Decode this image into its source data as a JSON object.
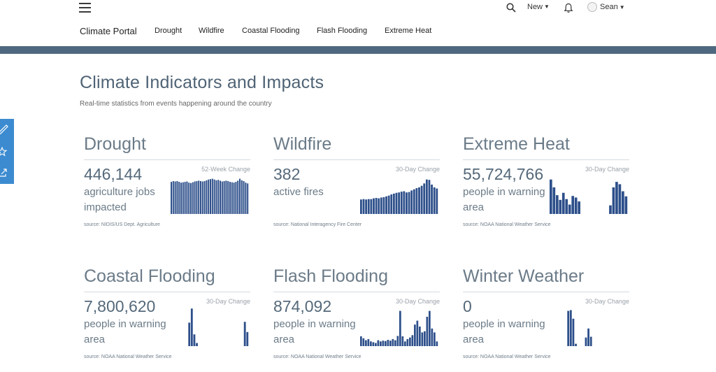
{
  "header": {
    "new_label": "New",
    "user_name": "Sean",
    "brand": "Climate Portal",
    "nav": [
      "Drought",
      "Wildfire",
      "Coastal Flooding",
      "Flash Flooding",
      "Extreme Heat"
    ]
  },
  "main": {
    "title": "Climate Indicators and Impacts",
    "subtitle": "Real-time statistics from events happening around the country"
  },
  "colors": {
    "accent_bar": "#4e687f",
    "side_tab": "#3c8bd0",
    "chart_bars": "#2d4f8a"
  },
  "icons": [
    "menu-icon",
    "search-icon",
    "bell-icon",
    "pencil-icon",
    "star-icon",
    "share-icon"
  ],
  "cards": [
    {
      "title": "Drought",
      "value": "446,144",
      "description": "agriculture jobs impacted",
      "change_label": "52-Week Change",
      "source": "source: NIDIS/US Dept. Agriculture",
      "series": [
        0.82,
        0.84,
        0.83,
        0.84,
        0.82,
        0.8,
        0.81,
        0.82,
        0.83,
        0.8,
        0.79,
        0.81,
        0.83,
        0.84,
        0.85,
        0.84,
        0.83,
        0.84,
        0.86,
        0.88,
        0.89,
        0.9,
        0.88,
        0.86,
        0.87,
        0.85,
        0.83,
        0.84,
        0.85,
        0.84,
        0.82,
        0.81,
        0.8,
        0.82,
        0.85,
        0.9,
        0.86,
        0.84,
        0.8,
        0.78
      ]
    },
    {
      "title": "Wildfire",
      "value": "382",
      "description": "active fires",
      "change_label": "30-Day Change",
      "source": "source: National Interagency Fire Center",
      "series": [
        0.37,
        0.38,
        0.37,
        0.38,
        0.38,
        0.4,
        0.41,
        0.4,
        0.42,
        0.43,
        0.45,
        0.47,
        0.5,
        0.52,
        0.54,
        0.55,
        0.57,
        0.58,
        0.55,
        0.56,
        0.6,
        0.63,
        0.66,
        0.68,
        0.72,
        0.78,
        0.88,
        0.87,
        0.75,
        0.68,
        0.65
      ]
    },
    {
      "title": "Extreme Heat",
      "value": "55,724,766",
      "description": "people in warning area",
      "change_label": "30-Day Change",
      "source": "source: NOAA National Weather Service",
      "series": [
        0.88,
        0.68,
        0.48,
        0.36,
        0.54,
        0.38,
        0.24,
        0.46,
        0.42,
        0.32,
        0,
        0,
        0,
        0,
        0,
        0,
        0,
        0,
        0,
        0.22,
        0.68,
        0.82,
        0.76,
        0.58,
        0.45
      ]
    },
    {
      "title": "Coastal Flooding",
      "value": "7,800,620",
      "description": "people in warning area",
      "change_label": "30-Day Change",
      "source": "source: NOAA National Weather Service",
      "series": [
        0,
        0,
        0,
        0,
        0,
        0,
        0,
        0.6,
        0.96,
        0.3,
        0.08,
        0,
        0,
        0,
        0,
        0,
        0,
        0,
        0,
        0,
        0,
        0,
        0,
        0,
        0,
        0,
        0,
        0,
        0,
        0.62,
        0.36
      ]
    },
    {
      "title": "Flash Flooding",
      "value": "874,092",
      "description": "people in warning area",
      "change_label": "30-Day Change",
      "source": "source: NOAA National Weather Service",
      "series": [
        0.25,
        0.2,
        0.15,
        0.18,
        0.12,
        0.1,
        0.08,
        0.15,
        0.12,
        0.14,
        0.13,
        0.16,
        0.14,
        0.18,
        0.15,
        0.26,
        0.9,
        0.25,
        0.12,
        0.18,
        0.22,
        0.28,
        0.55,
        0.65,
        0.5,
        0.35,
        0.38,
        0.75,
        0.9,
        0.45,
        0.35,
        0.12
      ]
    },
    {
      "title": "Winter Weather",
      "value": "0",
      "description": "people in warning area",
      "change_label": "30-Day Change",
      "source": "source: NOAA National Weather Service",
      "series": [
        0,
        0,
        0,
        0,
        0,
        0,
        0,
        0.9,
        0.92,
        0.7,
        0.06,
        0,
        0,
        0,
        0.22,
        0.45,
        0.24,
        0,
        0,
        0,
        0,
        0,
        0,
        0,
        0,
        0,
        0,
        0,
        0,
        0,
        0
      ]
    }
  ]
}
